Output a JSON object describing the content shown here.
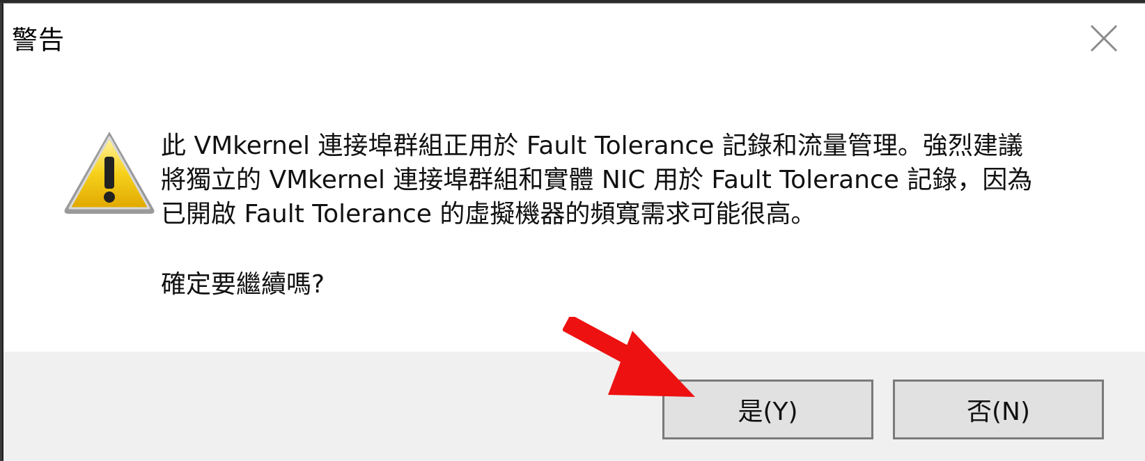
{
  "dialog": {
    "title": "警告",
    "icon": "warning-icon",
    "message_lines": [
      "此 VMkernel 連接埠群組正用於 Fault Tolerance 記錄和流量管理。強烈建議",
      "將獨立的 VMkernel 連接埠群組和實體 NIC 用於 Fault Tolerance 記錄，因為",
      "已開啟 Fault Tolerance 的虛擬機器的頻寬需求可能很高。"
    ],
    "question": "確定要繼續嗎?",
    "buttons": {
      "yes": "是(Y)",
      "no": "否(N)"
    }
  },
  "annotation": {
    "arrow_color": "#ee1111"
  }
}
